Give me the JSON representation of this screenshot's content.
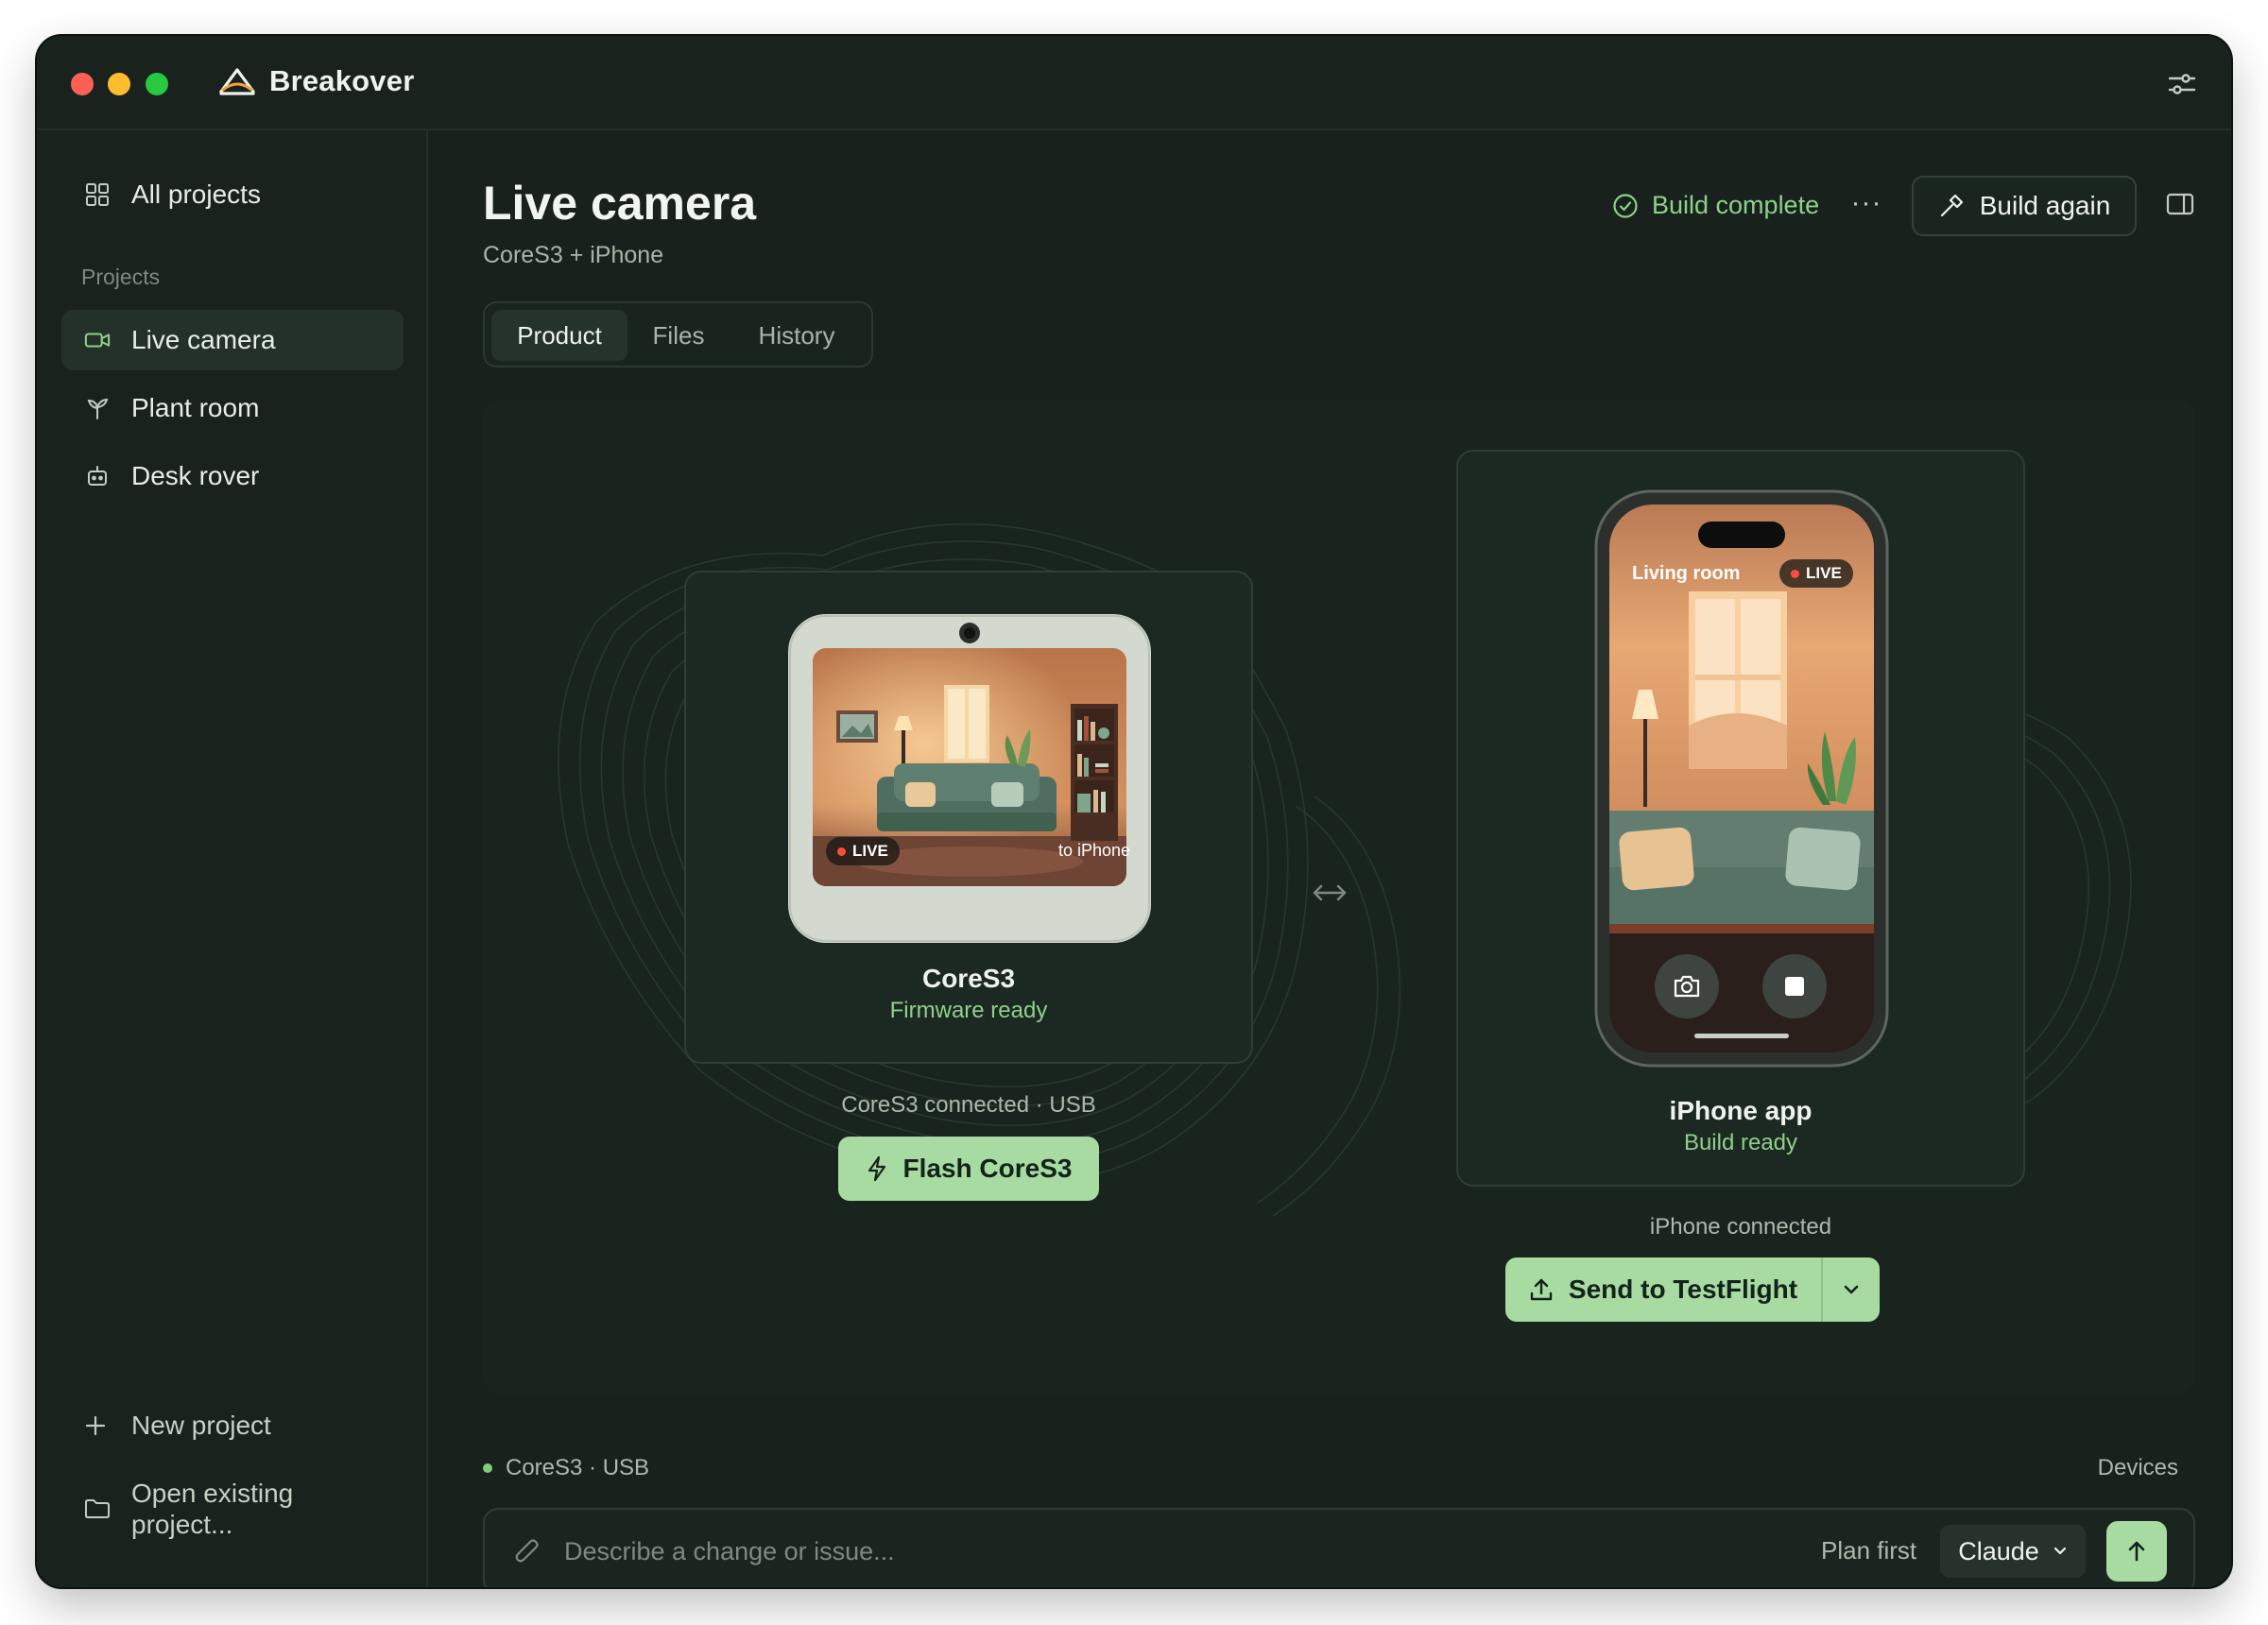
{
  "app": {
    "name": "Breakover"
  },
  "sidebar": {
    "all_projects": "All projects",
    "section_label": "Projects",
    "items": [
      {
        "label": "Live camera",
        "icon": "video-camera-icon",
        "active": true
      },
      {
        "label": "Plant room",
        "icon": "sprout-icon",
        "active": false
      },
      {
        "label": "Desk rover",
        "icon": "robot-icon",
        "active": false
      }
    ],
    "new_project": "New project",
    "open_existing_line1": "Open existing",
    "open_existing_line2": "project..."
  },
  "header": {
    "title": "Live camera",
    "subtitle": "CoreS3 + iPhone",
    "status": "Build complete",
    "more_label": "···",
    "build_again": "Build again"
  },
  "tabs": [
    {
      "label": "Product",
      "active": true
    },
    {
      "label": "Files",
      "active": false
    },
    {
      "label": "History",
      "active": false
    }
  ],
  "cores3": {
    "name": "CoreS3",
    "status": "Firmware ready",
    "live_badge": "LIVE",
    "stream_target": "to iPhone",
    "connection": "CoreS3 connected · USB",
    "action": "Flash CoreS3"
  },
  "iphone": {
    "name": "iPhone app",
    "status": "Build ready",
    "room_label": "Living room",
    "live_badge": "LIVE",
    "connection": "iPhone connected",
    "action": "Send to TestFlight"
  },
  "footer": {
    "device_status": "CoreS3 · USB",
    "devices_link": "Devices"
  },
  "composer": {
    "placeholder": "Describe a change or issue...",
    "plan_first": "Plan first",
    "model": "Claude"
  },
  "colors": {
    "accent": "#a8dba1",
    "status_green": "#8fd08a",
    "live_red": "#ff4d3d",
    "background": "#18211c"
  }
}
